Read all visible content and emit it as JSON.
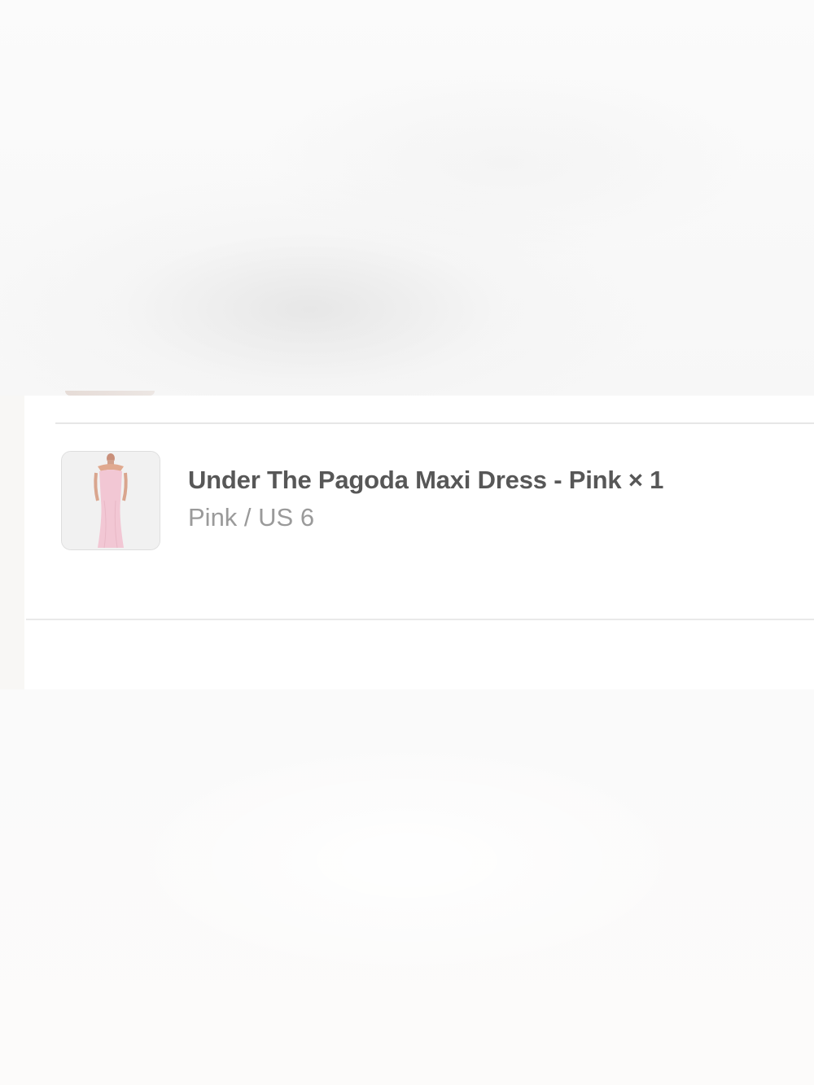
{
  "order": {
    "line_items": [
      {
        "title": "Under The Pagoda Maxi Dress - Pink × 1",
        "variant": "Pink / US 6",
        "thumbnail": "product-photo"
      }
    ]
  }
}
